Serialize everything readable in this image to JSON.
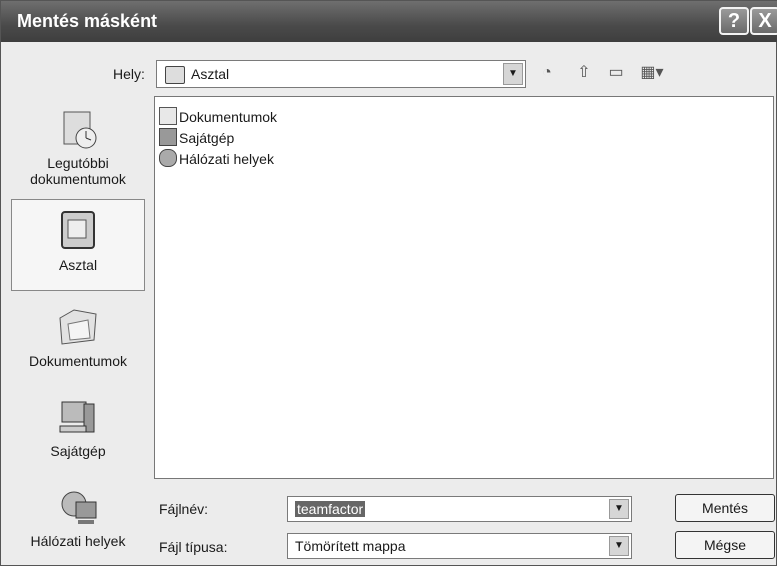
{
  "window": {
    "title": "Mentés másként",
    "help_glyph": "?",
    "close_glyph": "X"
  },
  "location": {
    "label": "Hely:",
    "value": "Asztal"
  },
  "toolbar": {
    "icons": [
      "back-icon",
      "up-folder-icon",
      "new-folder-icon",
      "view-menu-icon"
    ]
  },
  "places": [
    {
      "label": "Legutóbbi dokumentumok",
      "icon": "recent-documents-icon"
    },
    {
      "label": "Asztal",
      "icon": "desktop-icon"
    },
    {
      "label": "Dokumentumok",
      "icon": "documents-icon"
    },
    {
      "label": "Sajátgép",
      "icon": "my-computer-icon"
    },
    {
      "label": "Hálózati helyek",
      "icon": "network-places-icon"
    }
  ],
  "files": [
    {
      "name": "Dokumentumok",
      "icon": "documents-folder-icon"
    },
    {
      "name": "Sajátgép",
      "icon": "my-computer-icon"
    },
    {
      "name": "Hálózati helyek",
      "icon": "network-places-icon"
    }
  ],
  "filename": {
    "label": "Fájlnév:",
    "value": "teamfactor"
  },
  "filetype": {
    "label": "Fájl típusa:",
    "value": "Tömörített mappa"
  },
  "buttons": {
    "save": "Mentés",
    "cancel": "Mégse"
  }
}
